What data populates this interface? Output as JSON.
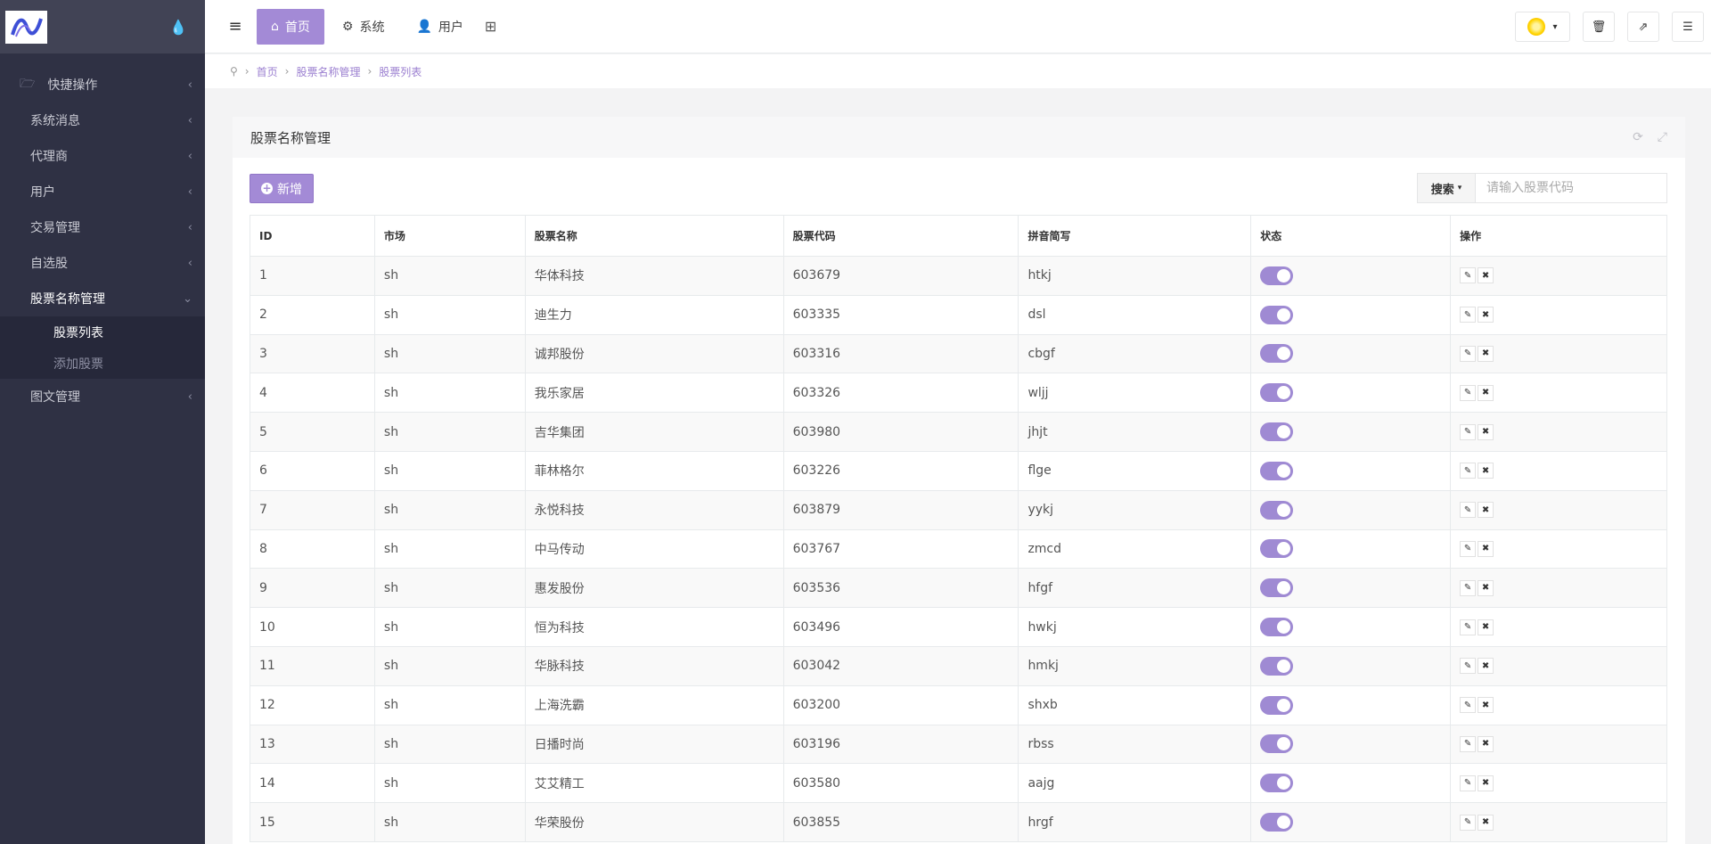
{
  "sidebar": {
    "items": [
      {
        "label": "快捷操作",
        "icon": "folder-icon"
      },
      {
        "label": "系统消息"
      },
      {
        "label": "代理商"
      },
      {
        "label": "用户"
      },
      {
        "label": "交易管理"
      },
      {
        "label": "自选股"
      },
      {
        "label": "股票名称管理"
      },
      {
        "label": "图文管理"
      }
    ],
    "submenu": [
      {
        "label": "股票列表"
      },
      {
        "label": "添加股票"
      }
    ]
  },
  "topbar": {
    "tabs": [
      {
        "label": "首页",
        "icon": "home-icon"
      },
      {
        "label": "系统",
        "icon": "gear-icon"
      },
      {
        "label": "用户",
        "icon": "user-icon"
      }
    ]
  },
  "breadcrumb": [
    "首页",
    "股票名称管理",
    "股票列表"
  ],
  "panel": {
    "title": "股票名称管理",
    "add_label": "新增",
    "search_label": "搜索",
    "search_placeholder": "请输入股票代码"
  },
  "table": {
    "columns": [
      "ID",
      "市场",
      "股票名称",
      "股票代码",
      "拼音简写",
      "状态",
      "操作"
    ],
    "rows": [
      {
        "id": "1",
        "market": "sh",
        "name": "华体科技",
        "code": "603679",
        "pinyin": "htkj"
      },
      {
        "id": "2",
        "market": "sh",
        "name": "迪生力",
        "code": "603335",
        "pinyin": "dsl"
      },
      {
        "id": "3",
        "market": "sh",
        "name": "诚邦股份",
        "code": "603316",
        "pinyin": "cbgf"
      },
      {
        "id": "4",
        "market": "sh",
        "name": "我乐家居",
        "code": "603326",
        "pinyin": "wljj"
      },
      {
        "id": "5",
        "market": "sh",
        "name": "吉华集团",
        "code": "603980",
        "pinyin": "jhjt"
      },
      {
        "id": "6",
        "market": "sh",
        "name": "菲林格尔",
        "code": "603226",
        "pinyin": "flge"
      },
      {
        "id": "7",
        "market": "sh",
        "name": "永悦科技",
        "code": "603879",
        "pinyin": "yykj"
      },
      {
        "id": "8",
        "market": "sh",
        "name": "中马传动",
        "code": "603767",
        "pinyin": "zmcd"
      },
      {
        "id": "9",
        "market": "sh",
        "name": "惠发股份",
        "code": "603536",
        "pinyin": "hfgf"
      },
      {
        "id": "10",
        "market": "sh",
        "name": "恒为科技",
        "code": "603496",
        "pinyin": "hwkj"
      },
      {
        "id": "11",
        "market": "sh",
        "name": "华脉科技",
        "code": "603042",
        "pinyin": "hmkj"
      },
      {
        "id": "12",
        "market": "sh",
        "name": "上海洗霸",
        "code": "603200",
        "pinyin": "shxb"
      },
      {
        "id": "13",
        "market": "sh",
        "name": "日播时尚",
        "code": "603196",
        "pinyin": "rbss"
      },
      {
        "id": "14",
        "market": "sh",
        "name": "艾艾精工",
        "code": "603580",
        "pinyin": "aajg"
      },
      {
        "id": "15",
        "market": "sh",
        "name": "华荣股份",
        "code": "603855",
        "pinyin": "hrgf"
      }
    ]
  },
  "colors": {
    "accent": "#a38ad6",
    "sidebar_bg": "#2f3144"
  }
}
